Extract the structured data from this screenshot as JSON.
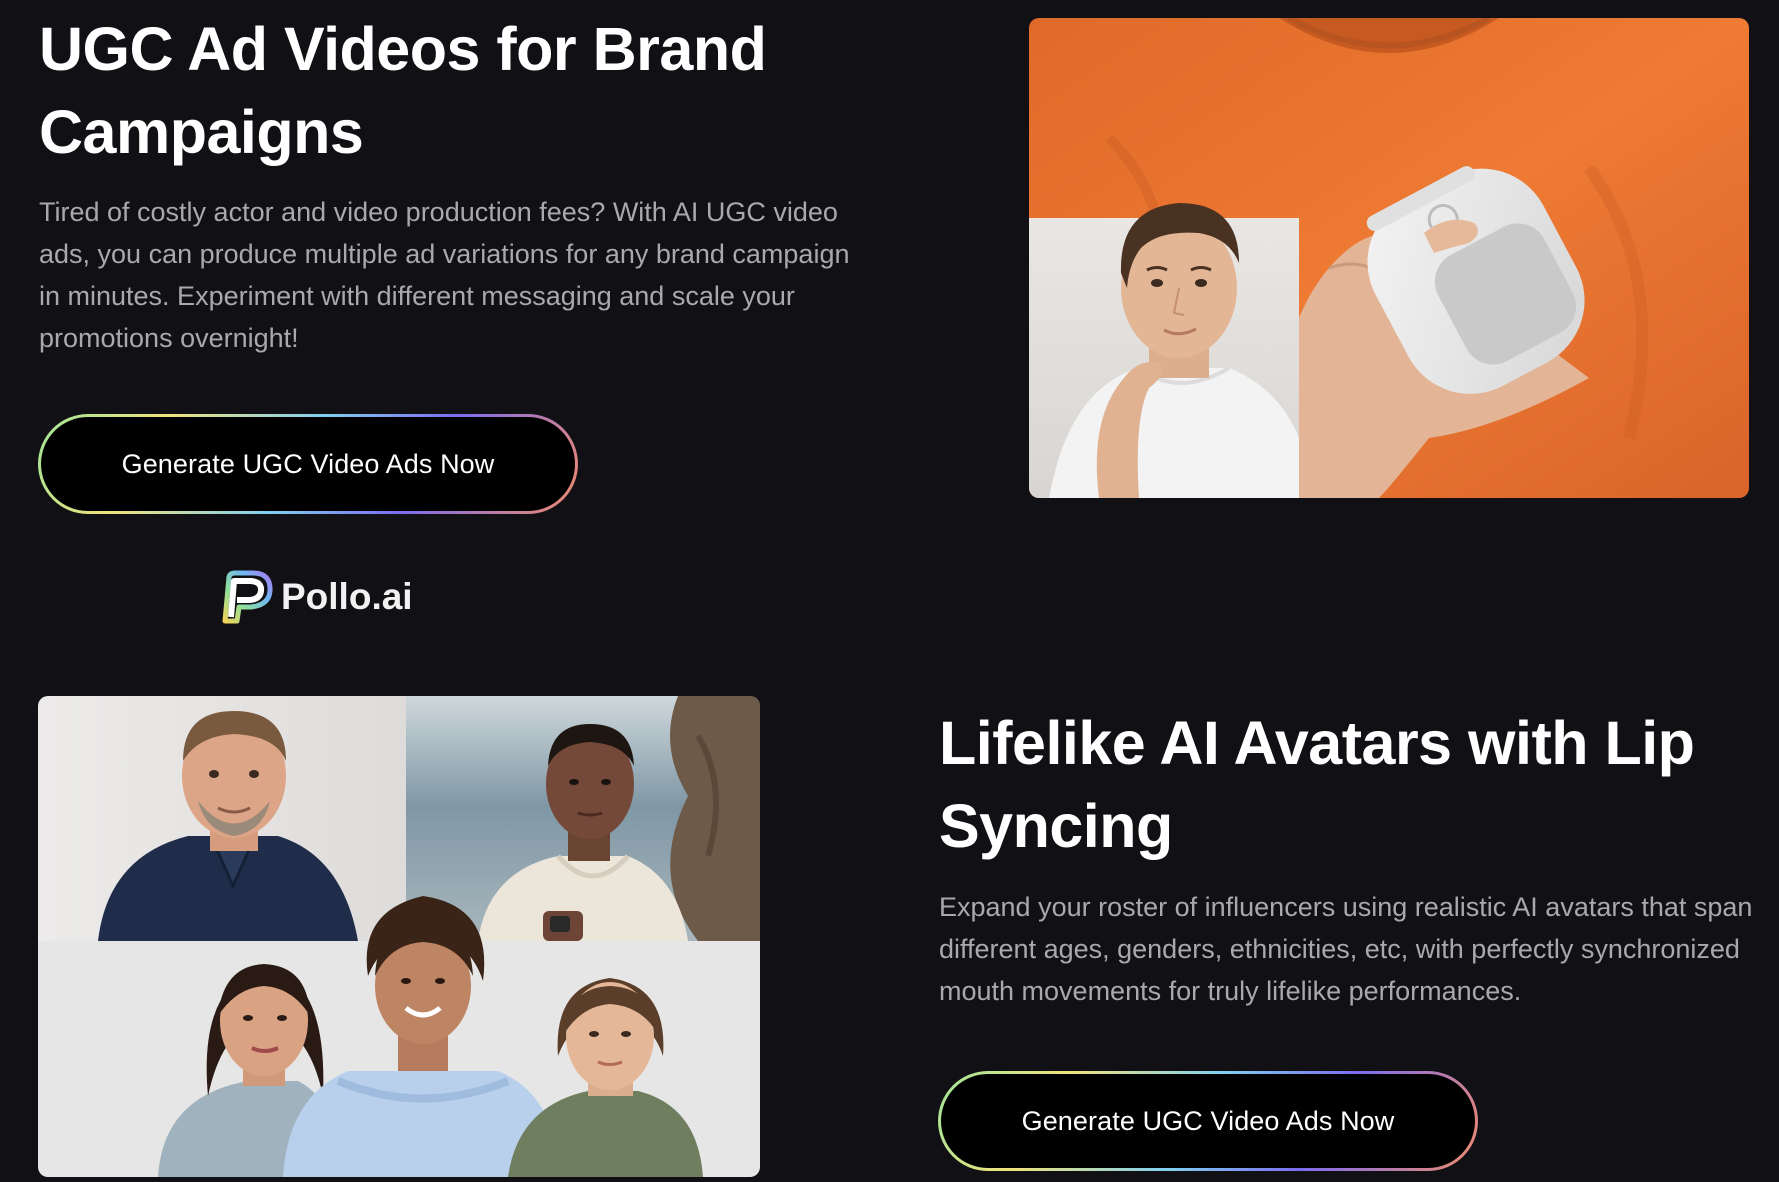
{
  "section1": {
    "heading_line1": "UGC Ad Videos for Brand",
    "heading_line2": "Campaigns",
    "description": "Tired of costly actor and video production fees? With AI UGC video ads, you can produce multiple ad variations for any brand campaign in minutes. Experiment with different messaging and scale your promotions overnight!",
    "cta_label": "Generate UGC Video Ads Now",
    "image_icon": "person-with-product-photo"
  },
  "logo": {
    "text": "Pollo.ai",
    "icon": "pollo-p-logo-icon"
  },
  "section2": {
    "heading_line1": "Lifelike AI Avatars with Lip",
    "heading_line2": "Syncing",
    "description": "Expand your roster of influencers using realistic AI avatars that span different ages, genders, ethnicities, etc, with perfectly synchronized mouth movements for truly lifelike performances.",
    "cta_label": "Generate UGC Video Ads Now",
    "image_icon": "avatars-collage-photo"
  },
  "colors": {
    "background": "#111014",
    "heading": "#ffffff",
    "body_text": "#a9a8ad",
    "button_bg": "#000000",
    "button_border_gradient": [
      "#9ee59a",
      "#f0e27a",
      "#7fd0f0",
      "#7c6cf0",
      "#f08a6a"
    ],
    "shirt_orange": "#e8742f"
  }
}
